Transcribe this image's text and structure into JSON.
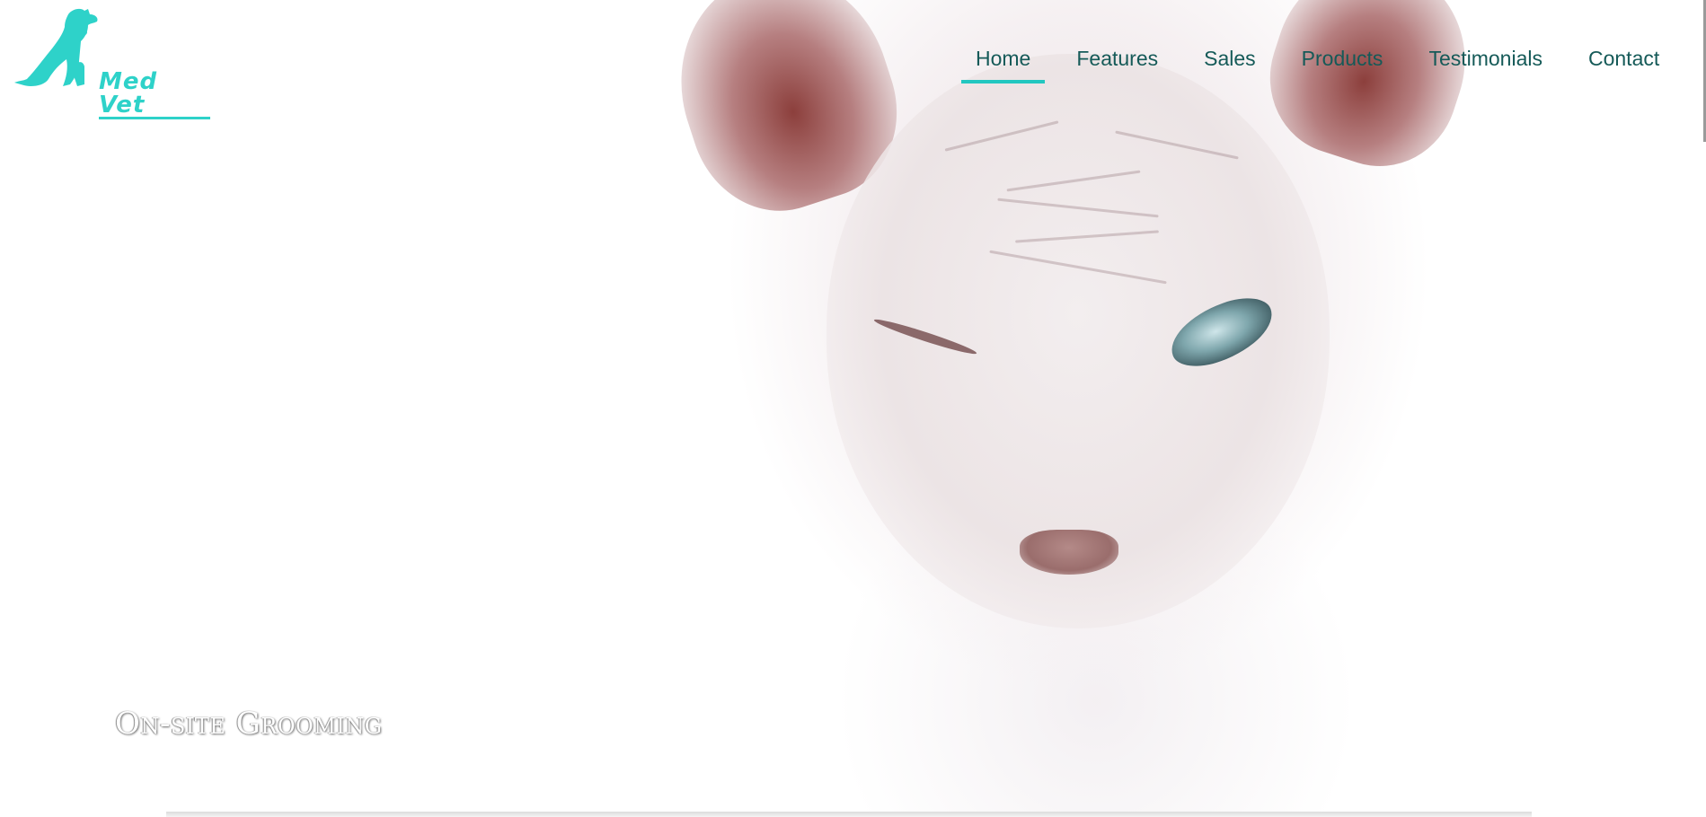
{
  "brand": {
    "name": "Med Vet",
    "accent_color": "#2ed2c9",
    "logo_icon": "dog-and-cat-silhouette-icon"
  },
  "nav": {
    "items": [
      {
        "label": "Home",
        "active": true
      },
      {
        "label": "Features",
        "active": false
      },
      {
        "label": "Sales",
        "active": false
      },
      {
        "label": "Products",
        "active": false
      },
      {
        "label": "Testimonials",
        "active": false
      },
      {
        "label": "Contact",
        "active": false
      }
    ],
    "text_color": "#155a58",
    "active_underline_color": "#22c7c0"
  },
  "hero": {
    "caption": "On-site Grooming",
    "image_subject": "hairless sphynx cat"
  }
}
